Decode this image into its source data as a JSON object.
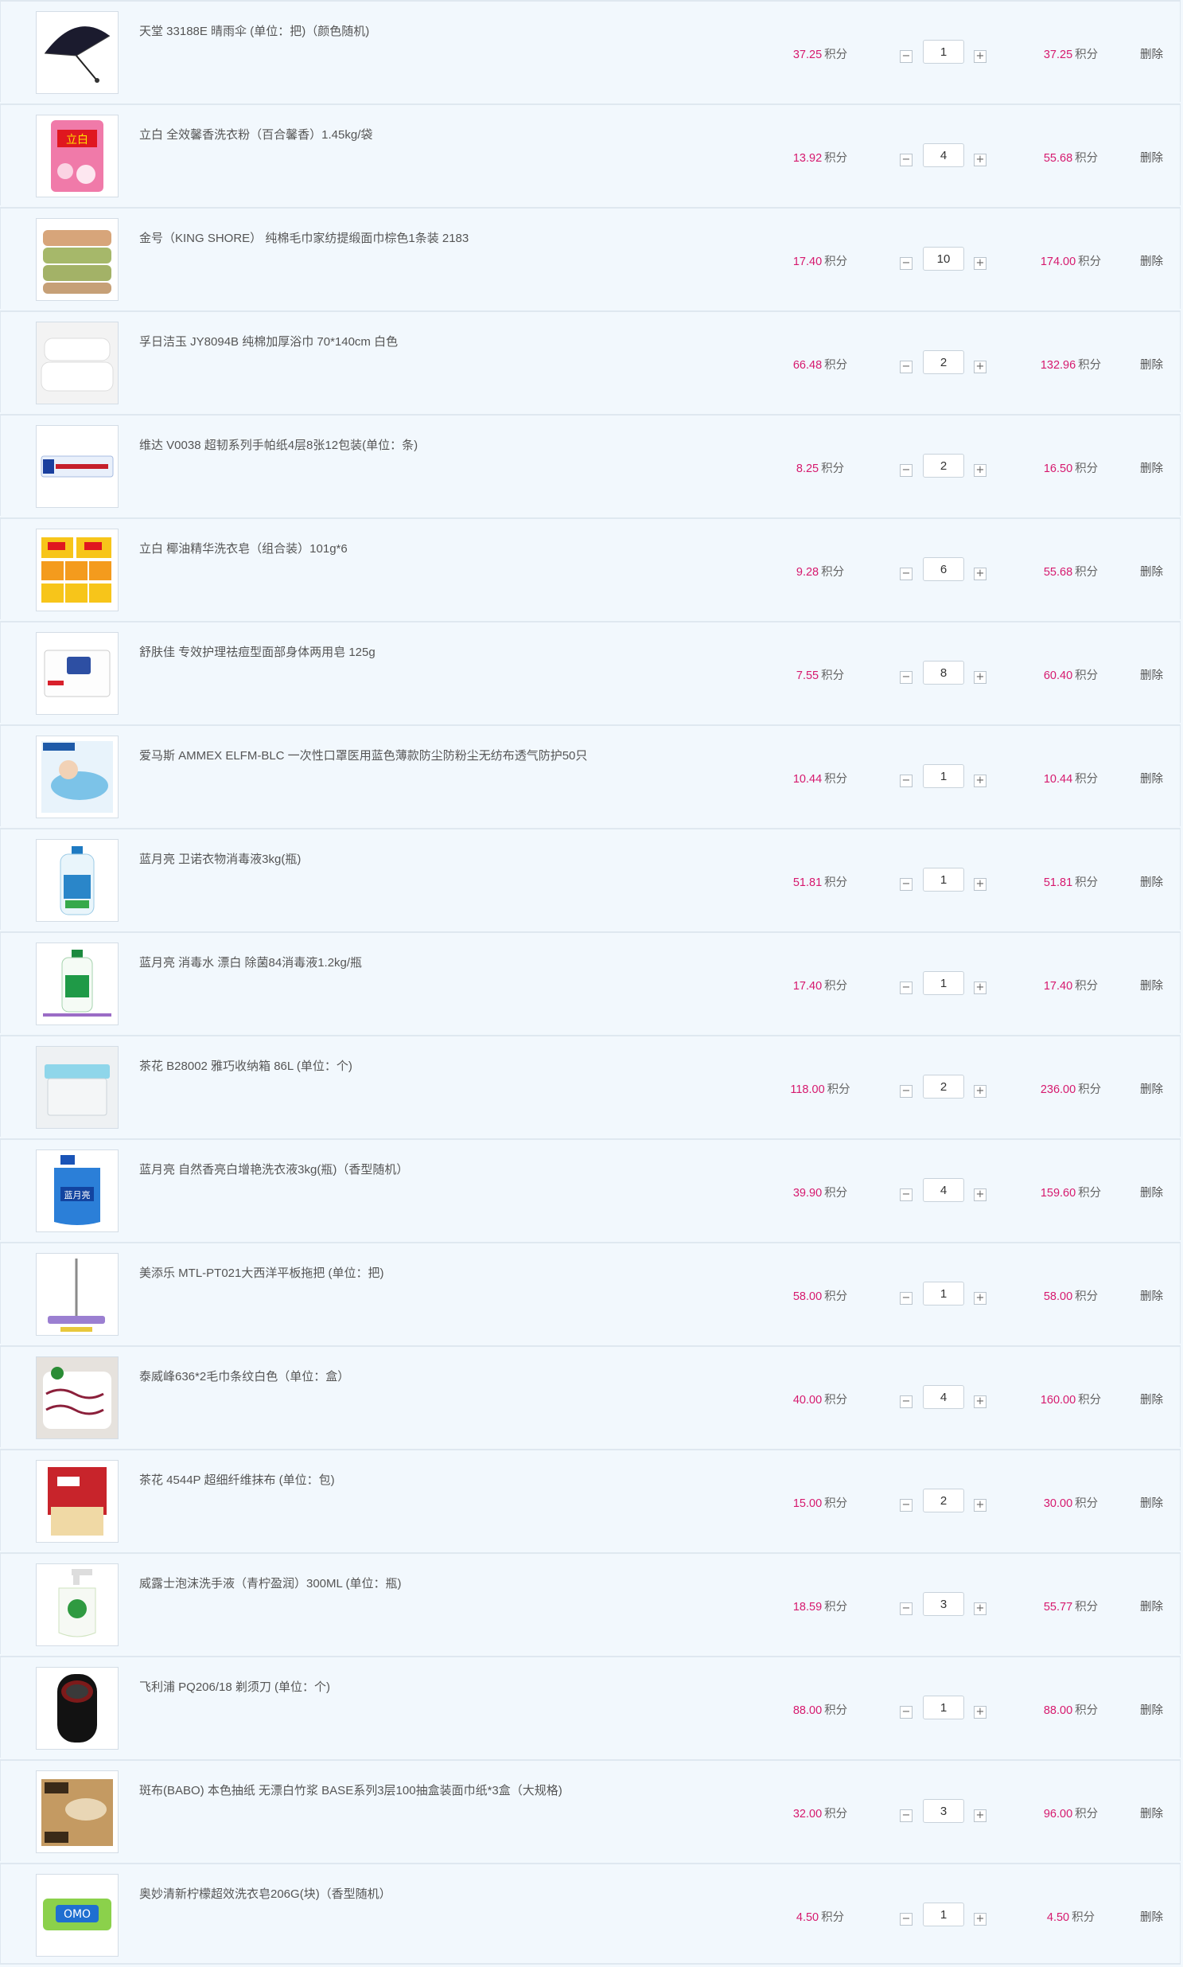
{
  "cart": {
    "items": [
      {
        "name": "天堂 33188E 晴雨伞 (单位：把)（颜色随机)",
        "price": "37.25",
        "unit": "积分",
        "qty": "1",
        "subtotal": "37.25",
        "delete": "删除",
        "image": "umbrella"
      },
      {
        "name": "立白 全效馨香洗衣粉（百合馨香）1.45kg/袋",
        "price": "13.92",
        "unit": "积分",
        "qty": "4",
        "subtotal": "55.68",
        "delete": "删除",
        "image": "detergent-bag"
      },
      {
        "name": "金号（KING SHORE） 纯棉毛巾家纺提缎面巾棕色1条装 2183",
        "price": "17.40",
        "unit": "积分",
        "qty": "10",
        "subtotal": "174.00",
        "delete": "删除",
        "image": "towel-stack"
      },
      {
        "name": "孚日洁玉 JY8094B 纯棉加厚浴巾 70*140cm 白色",
        "price": "66.48",
        "unit": "积分",
        "qty": "2",
        "subtotal": "132.96",
        "delete": "删除",
        "image": "white-towel"
      },
      {
        "name": "维达 V0038 超韧系列手帕纸4层8张12包装(单位：条)",
        "price": "8.25",
        "unit": "积分",
        "qty": "2",
        "subtotal": "16.50",
        "delete": "删除",
        "image": "tissue-pack"
      },
      {
        "name": "立白 椰油精华洗衣皂（组合装）101g*6",
        "price": "9.28",
        "unit": "积分",
        "qty": "6",
        "subtotal": "55.68",
        "delete": "删除",
        "image": "soap-boxes"
      },
      {
        "name": "舒肤佳 专效护理祛痘型面部身体两用皂 125g",
        "price": "7.55",
        "unit": "积分",
        "qty": "8",
        "subtotal": "60.40",
        "delete": "删除",
        "image": "soap-bar"
      },
      {
        "name": "爱马斯 AMMEX ELFM-BLC 一次性口罩医用蓝色薄款防尘防粉尘无纺布透气防护50只",
        "price": "10.44",
        "unit": "积分",
        "qty": "1",
        "subtotal": "10.44",
        "delete": "删除",
        "image": "face-mask"
      },
      {
        "name": "蓝月亮 卫诺衣物消毒液3kg(瓶)",
        "price": "51.81",
        "unit": "积分",
        "qty": "1",
        "subtotal": "51.81",
        "delete": "删除",
        "image": "disinfectant-bottle"
      },
      {
        "name": "蓝月亮 消毒水 漂白 除菌84消毒液1.2kg/瓶",
        "price": "17.40",
        "unit": "积分",
        "qty": "1",
        "subtotal": "17.40",
        "delete": "删除",
        "image": "bleach-bottle"
      },
      {
        "name": "茶花 B28002 雅巧收纳箱 86L (单位：个)",
        "price": "118.00",
        "unit": "积分",
        "qty": "2",
        "subtotal": "236.00",
        "delete": "删除",
        "image": "storage-box"
      },
      {
        "name": "蓝月亮 自然香亮白增艳洗衣液3kg(瓶)（香型随机）",
        "price": "39.90",
        "unit": "积分",
        "qty": "4",
        "subtotal": "159.60",
        "delete": "删除",
        "image": "laundry-liquid"
      },
      {
        "name": "美添乐 MTL-PT021大西洋平板拖把 (单位：把)",
        "price": "58.00",
        "unit": "积分",
        "qty": "1",
        "subtotal": "58.00",
        "delete": "删除",
        "image": "flat-mop"
      },
      {
        "name": "泰威峰636*2毛巾条纹白色（单位：盒）",
        "price": "40.00",
        "unit": "积分",
        "qty": "4",
        "subtotal": "160.00",
        "delete": "删除",
        "image": "striped-towel"
      },
      {
        "name": "茶花 4544P 超细纤维抹布 (单位：包)",
        "price": "15.00",
        "unit": "积分",
        "qty": "2",
        "subtotal": "30.00",
        "delete": "删除",
        "image": "cleaning-cloth"
      },
      {
        "name": "威露士泡沫洗手液（青柠盈润）300ML (单位：瓶)",
        "price": "18.59",
        "unit": "积分",
        "qty": "3",
        "subtotal": "55.77",
        "delete": "删除",
        "image": "hand-soap"
      },
      {
        "name": "飞利浦 PQ206/18 剃须刀 (单位：个)",
        "price": "88.00",
        "unit": "积分",
        "qty": "1",
        "subtotal": "88.00",
        "delete": "删除",
        "image": "shaver"
      },
      {
        "name": "斑布(BABO) 本色抽纸 无漂白竹浆 BASE系列3层100抽盒装面巾纸*3盒（大规格)",
        "price": "32.00",
        "unit": "积分",
        "qty": "3",
        "subtotal": "96.00",
        "delete": "删除",
        "image": "tissue-boxes"
      },
      {
        "name": "奥妙清新柠檬超效洗衣皂206G(块)（香型随机）",
        "price": "4.50",
        "unit": "积分",
        "qty": "1",
        "subtotal": "4.50",
        "delete": "删除",
        "image": "laundry-soap"
      }
    ],
    "qty_minus_symbol": "−",
    "qty_plus_symbol": "+"
  },
  "colors": {
    "price": "#d6196e",
    "row_background": "#f2f8fd",
    "row_border": "#dfe8f0"
  }
}
